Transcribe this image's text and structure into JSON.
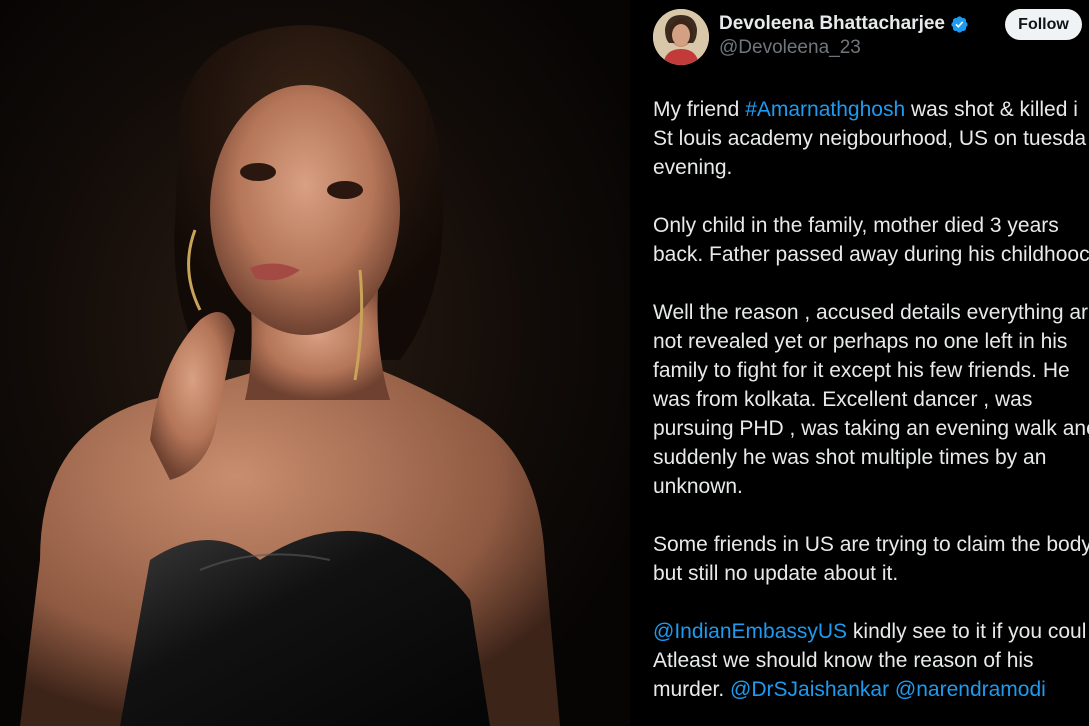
{
  "photo": {
    "alt": "Woman in black strapless dress against dark background"
  },
  "tweet": {
    "author": {
      "display_name": "Devoleena Bhattacharjee",
      "handle": "@Devoleena_23",
      "verified_icon": "verified-badge-icon"
    },
    "follow_label": "Follow",
    "paragraphs": [
      {
        "lines": [
          [
            {
              "t": "My friend "
            },
            {
              "t": "#Amarnathghosh",
              "link": true
            },
            {
              "t": " was shot & killed i"
            }
          ],
          [
            {
              "t": "St louis academy neigbourhood, US on tuesda"
            }
          ],
          [
            {
              "t": "evening."
            }
          ]
        ]
      },
      {
        "lines": [
          [
            {
              "t": "Only child in the family, mother died 3 years"
            }
          ],
          [
            {
              "t": "back. Father passed away during his childhooc"
            }
          ]
        ]
      },
      {
        "lines": [
          [
            {
              "t": "Well the reason , accused details everything ar"
            }
          ],
          [
            {
              "t": "not revealed yet or perhaps no one left in his"
            }
          ],
          [
            {
              "t": "family to fight for it except his few friends. He"
            }
          ],
          [
            {
              "t": "was from kolkata. Excellent dancer , was"
            }
          ],
          [
            {
              "t": "pursuing PHD , was taking an evening walk anc"
            }
          ],
          [
            {
              "t": "suddenly he was shot multiple times by an"
            }
          ],
          [
            {
              "t": "unknown."
            }
          ]
        ]
      },
      {
        "lines": [
          [
            {
              "t": "Some friends in US are trying to claim the body"
            }
          ],
          [
            {
              "t": "but still no update about it."
            }
          ]
        ]
      },
      {
        "lines": [
          [
            {
              "t": "@IndianEmbassyUS",
              "link": true
            },
            {
              "t": " kindly see to it if you coul"
            }
          ],
          [
            {
              "t": "Atleast we should know the reason of his"
            }
          ],
          [
            {
              "t": "murder. "
            },
            {
              "t": "@DrSJaishankar",
              "link": true
            },
            {
              "t": " "
            },
            {
              "t": "@narendramodi",
              "link": true
            }
          ]
        ]
      }
    ]
  },
  "colors": {
    "background": "#000000",
    "text": "#e7e9ea",
    "secondary_text": "#71767b",
    "link": "#1d9bf0",
    "follow_button_bg": "#eff3f4"
  }
}
